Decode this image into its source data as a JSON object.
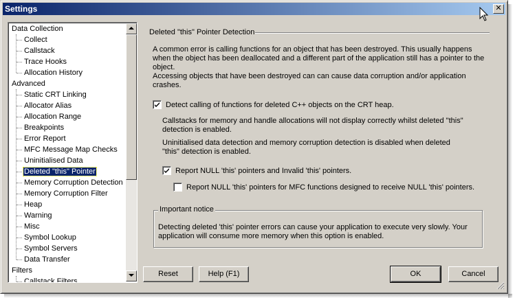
{
  "window": {
    "title": "Settings",
    "close_glyph": "✕"
  },
  "tree": {
    "items": [
      {
        "label": "Data Collection",
        "level": 0
      },
      {
        "label": "Collect",
        "level": 1
      },
      {
        "label": "Callstack",
        "level": 1
      },
      {
        "label": "Trace Hooks",
        "level": 1
      },
      {
        "label": "Allocation History",
        "level": 1
      },
      {
        "label": "Advanced",
        "level": 0
      },
      {
        "label": "Static CRT Linking",
        "level": 1
      },
      {
        "label": "Allocator Alias",
        "level": 1
      },
      {
        "label": "Allocation Range",
        "level": 1
      },
      {
        "label": "Breakpoints",
        "level": 1
      },
      {
        "label": "Error Report",
        "level": 1
      },
      {
        "label": "MFC Message Map Checks",
        "level": 1
      },
      {
        "label": "Uninitialised Data",
        "level": 1
      },
      {
        "label": "Deleted \"this\" Pointer",
        "level": 1,
        "selected": true
      },
      {
        "label": "Memory Corruption Detection",
        "level": 1
      },
      {
        "label": "Memory Corruption Filter",
        "level": 1
      },
      {
        "label": "Heap",
        "level": 1
      },
      {
        "label": "Warning",
        "level": 1
      },
      {
        "label": "Misc",
        "level": 1
      },
      {
        "label": "Symbol Lookup",
        "level": 1
      },
      {
        "label": "Symbol Servers",
        "level": 1
      },
      {
        "label": "Data Transfer",
        "level": 1
      },
      {
        "label": "Filters",
        "level": 0
      },
      {
        "label": "Callstack Filters",
        "level": 1
      }
    ]
  },
  "panel": {
    "group_title": "Deleted \"this\" Pointer Detection",
    "intro_1": "A common error is calling functions for an object that has been destroyed. This usually happens when the object has been deallocated and a different part of the application still has a pointer to the object.",
    "intro_2": "Accessing objects that have been destroyed can can cause data corruption and/or application crashes.",
    "detect_checkbox": {
      "label": "Detect calling of functions for deleted C++ objects on the CRT heap.",
      "checked": true
    },
    "note_1": "Callstacks for memory and handle allocations will not display correctly whilst deleted \"this\" detection is enabled.",
    "note_2": "Uninitialised data detection and memory corruption detection is disabled when deleted \"this\" detection is enabled.",
    "report_null_checkbox": {
      "label": "Report NULL 'this' pointers and Invalid 'this' pointers.",
      "checked": true
    },
    "report_mfc_checkbox": {
      "label": "Report NULL 'this' pointers for MFC functions designed to receive NULL 'this' pointers.",
      "checked": false
    },
    "notice": {
      "title": "Important notice",
      "text": "Detecting deleted 'this' pointer errors can cause your application to execute very slowly. Your application will consume more memory when this option is enabled."
    }
  },
  "buttons": {
    "reset": "Reset",
    "help": "Help (F1)",
    "ok": "OK",
    "cancel": "Cancel"
  },
  "colors": {
    "title_start": "#0a246a",
    "title_end": "#a6caf0",
    "face": "#d4d0c8",
    "selection": "#0a246a"
  }
}
